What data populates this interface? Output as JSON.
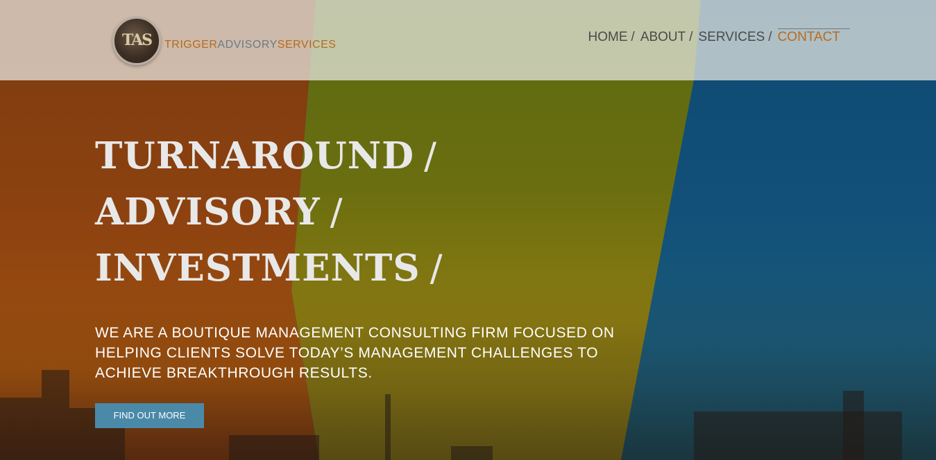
{
  "brand": {
    "logo_mark": "TAS",
    "name_part1": "TRIGGER",
    "name_part2": "ADVISORY",
    "name_part3": "SERVICES"
  },
  "nav": {
    "items": [
      {
        "label": "HOME",
        "separator": "/"
      },
      {
        "label": "ABOUT",
        "separator": "/"
      },
      {
        "label": "SERVICES",
        "separator": "/"
      },
      {
        "label": "CONTACT",
        "separator": ""
      }
    ],
    "active": "CONTACT"
  },
  "hero": {
    "lines": [
      {
        "text": "TURNAROUND",
        "slash": "/"
      },
      {
        "text": "ADVISORY",
        "slash": "/"
      },
      {
        "text": "INVESTMENTS",
        "slash": "/"
      }
    ],
    "description": "WE ARE A BOUTIQUE MANAGEMENT CONSULTING FIRM FOCUSED ON HELPING CLIENTS SOLVE TODAY’S MANAGEMENT CHALLENGES TO ACHIEVE BREAKTHROUGH RESULTS.",
    "cta_label": "FIND OUT MORE"
  },
  "colors": {
    "accent": "#b86b1e",
    "button": "#4a8aa8",
    "band_orange": "#8a3f0e",
    "band_green": "#6a6e10",
    "band_blue": "#125079"
  }
}
